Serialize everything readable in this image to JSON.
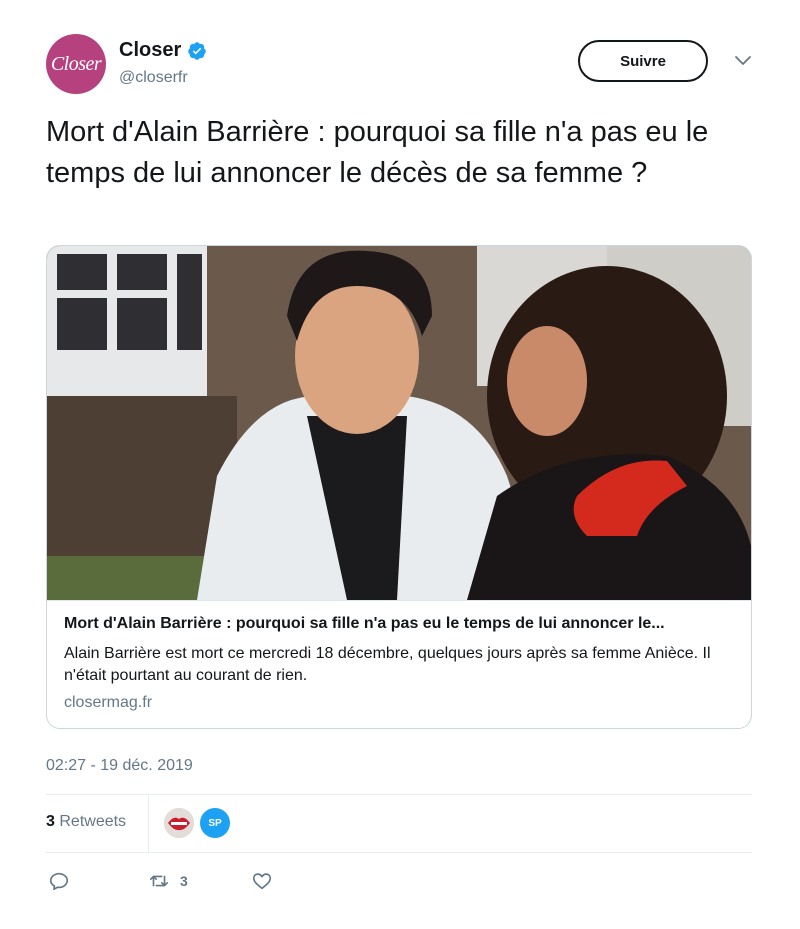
{
  "header": {
    "avatar_text": "Closer",
    "display_name": "Closer",
    "handle": "@closerfr",
    "follow_label": "Suivre"
  },
  "tweet": {
    "text": "Mort d'Alain Barrière : pourquoi sa fille n'a pas eu le temps de lui annoncer le décès de sa femme ?"
  },
  "card": {
    "title": "Mort d'Alain Barrière : pourquoi sa fille n'a pas eu le temps de lui annoncer le...",
    "description": "Alain Barrière est mort ce mercredi 18 décembre, quelques jours après sa femme Anièce. Il n'était pourtant au courant de rien.",
    "domain": "closermag.fr"
  },
  "timestamp": "02:27 - 19 déc. 2019",
  "stats": {
    "retweet_count": "3",
    "retweet_label": "Retweets",
    "avatar2_text": "SP"
  },
  "actions": {
    "retweet_count": "3"
  },
  "colors": {
    "brand": "#b5427f",
    "verified": "#1da1f2",
    "muted": "#657786",
    "text": "#14171a"
  }
}
